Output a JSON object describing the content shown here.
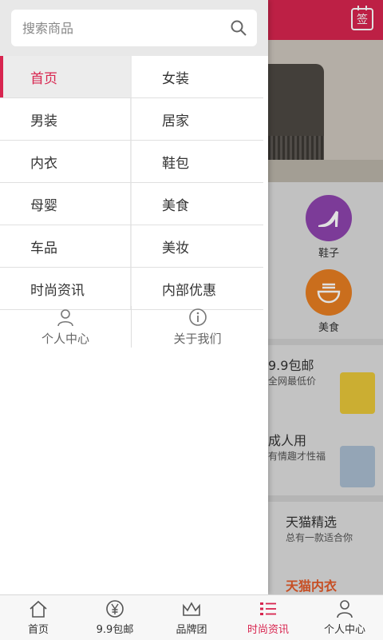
{
  "search": {
    "placeholder": "搜索商品"
  },
  "header": {
    "sign_label": "签"
  },
  "menu": {
    "rows": [
      [
        "首页",
        "女装"
      ],
      [
        "男装",
        "居家"
      ],
      [
        "内衣",
        "鞋包"
      ],
      [
        "母婴",
        "美食"
      ],
      [
        "车品",
        "美妆"
      ],
      [
        "时尚资讯",
        "内部优惠"
      ]
    ],
    "active": "首页"
  },
  "drawer_actions": [
    {
      "label": "个人中心",
      "icon": "person-icon"
    },
    {
      "label": "关于我们",
      "icon": "info-icon"
    }
  ],
  "background": {
    "categories": [
      {
        "label": "鞋子",
        "color": "#8e44ad",
        "icon": "high-heel-icon"
      },
      {
        "label": "美食",
        "color": "#e67e22",
        "icon": "bowl-icon"
      }
    ],
    "promos": [
      {
        "title": "9.9包邮",
        "subtitle": "全网最低价"
      },
      {
        "title": "成人用",
        "subtitle": "有情趣才性福"
      },
      {
        "title": "天猫精选",
        "subtitle": "总有一款适合你"
      },
      {
        "title": "天猫内衣",
        "subtitle": ""
      }
    ]
  },
  "tabbar": {
    "tabs": [
      {
        "label": "首页",
        "icon": "home-icon"
      },
      {
        "label": "9.9包邮",
        "icon": "yen-icon"
      },
      {
        "label": "品牌团",
        "icon": "crown-icon"
      },
      {
        "label": "时尚资讯",
        "icon": "list-icon"
      },
      {
        "label": "个人中心",
        "icon": "person-icon"
      }
    ],
    "active_index": 3,
    "active_color": "#d8254f"
  },
  "colors": {
    "accent": "#d8254f",
    "drawer_bg": "#ffffff"
  }
}
